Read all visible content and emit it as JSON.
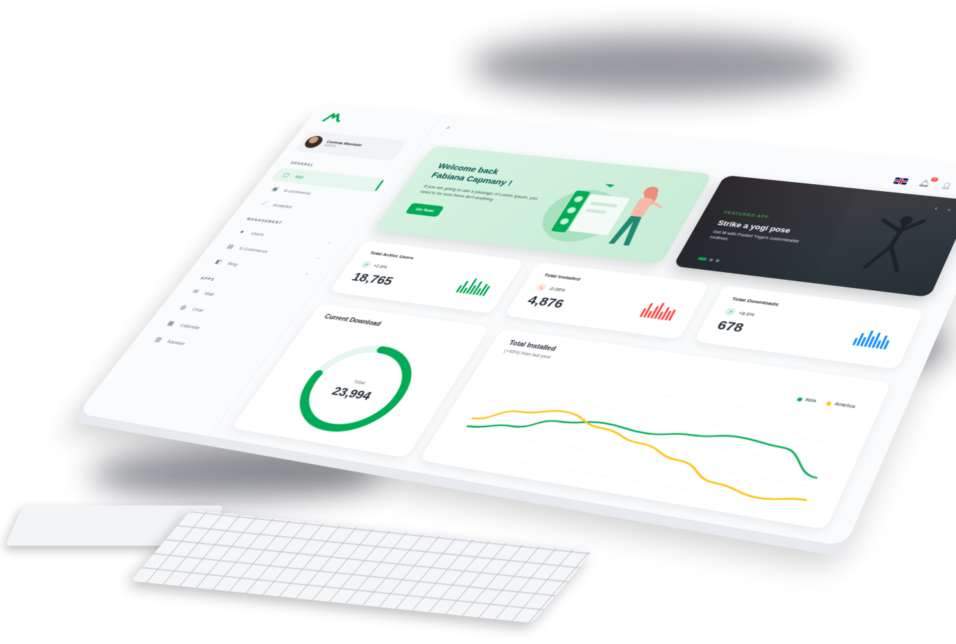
{
  "sidebar": {
    "account": {
      "name": "Corinia Montoie",
      "role": "Admin"
    },
    "sections": [
      {
        "heading": "GENERAL",
        "items": [
          {
            "label": "App",
            "icon": "dashboard-icon"
          },
          {
            "label": "E-commerce",
            "icon": "cart-icon"
          },
          {
            "label": "Analytics",
            "icon": "chart-icon"
          }
        ]
      },
      {
        "heading": "MANAGEMENT",
        "items": [
          {
            "label": "Users",
            "icon": "user-icon"
          },
          {
            "label": "E-Commerce",
            "icon": "cart-icon"
          },
          {
            "label": "Blog",
            "icon": "blog-icon"
          }
        ]
      },
      {
        "heading": "APPS",
        "items": [
          {
            "label": "Mail",
            "icon": "mail-icon"
          },
          {
            "label": "Chat",
            "icon": "chat-icon"
          },
          {
            "label": "Calendar",
            "icon": "calendar-icon"
          },
          {
            "label": "Kanban",
            "icon": "kanban-icon"
          }
        ]
      }
    ]
  },
  "topbar": {
    "notification_count": "2"
  },
  "welcome": {
    "title_line1": "Welcome back",
    "title_line2": "Fabiana Capmany !",
    "text": "If you are going to use a passage of Lorem Ipsum, you need to be sure there isn't anything",
    "button": "Go Now"
  },
  "featured": {
    "tag": "FEATURED APP",
    "title": "Strike a yogi pose",
    "text": "Get fit with Pocket Yoga's customizable routines."
  },
  "stats": [
    {
      "title": "Total Active Users",
      "trend": "+2.6%",
      "direction": "up",
      "value": "18,765",
      "color": "#00ab55",
      "bars": [
        0.45,
        0.75,
        0.35,
        0.95,
        0.55,
        0.8,
        0.4,
        0.7,
        0.6
      ]
    },
    {
      "title": "Total Installed",
      "trend": "-0.06%",
      "direction": "down",
      "value": "4,876",
      "color": "#ff4842",
      "bars": [
        0.5,
        0.85,
        0.4,
        0.7,
        0.95,
        0.45,
        0.75,
        0.55,
        0.65
      ]
    },
    {
      "title": "Total Downloads",
      "trend": "+8.6%",
      "direction": "up",
      "value": "678",
      "color": "#1890ff",
      "bars": [
        0.4,
        0.7,
        0.5,
        0.9,
        0.6,
        0.85,
        0.45,
        0.75,
        0.5
      ]
    }
  ],
  "current_download": {
    "title": "Current Download",
    "total_label": "Total",
    "total_value": "23,994",
    "progress": 0.78,
    "color": "#00ab55"
  },
  "total_installed": {
    "title": "Total Installed",
    "subtitle": "(+43%) than last year",
    "legend": [
      {
        "name": "Asia",
        "color": "#00ab55"
      },
      {
        "name": "America",
        "color": "#ffc107"
      }
    ]
  },
  "chart_data": {
    "type": "line",
    "title": "Total Installed",
    "x": [
      1,
      2,
      3,
      4,
      5,
      6,
      7,
      8,
      9
    ],
    "ylim": [
      0,
      100
    ],
    "series": [
      {
        "name": "Asia",
        "values": [
          30,
          38,
          52,
          58,
          54,
          60,
          66,
          62,
          35
        ],
        "color": "#00ab55"
      },
      {
        "name": "America",
        "values": [
          40,
          56,
          64,
          52,
          42,
          30,
          12,
          4,
          10
        ],
        "color": "#ffc107"
      }
    ]
  }
}
